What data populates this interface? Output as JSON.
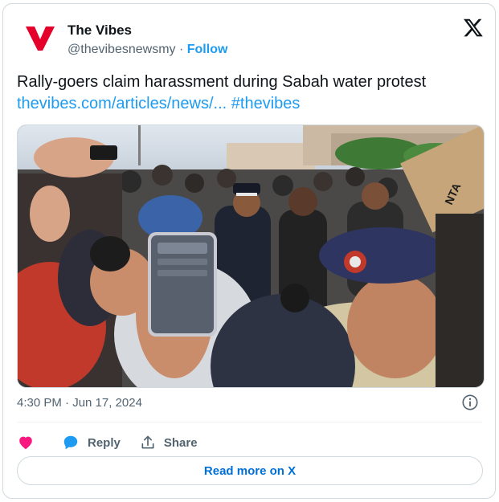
{
  "account": {
    "display_name": "The Vibes",
    "handle": "@thevibesnewsmy",
    "separator": "·",
    "follow_label": "Follow",
    "brand_color": "#e4002b"
  },
  "tweet": {
    "text": "Rally-goers claim harassment during Sabah water protest",
    "link": "thevibes.com/articles/news/...",
    "hashtag": "#thevibes"
  },
  "media": {
    "placard_text": "NTA"
  },
  "meta": {
    "timestamp": "4:30 PM · Jun 17, 2024"
  },
  "actions": {
    "reply_label": "Reply",
    "share_label": "Share"
  },
  "footer": {
    "read_more_label": "Read more on X"
  },
  "colors": {
    "accent": "#1d9bf0",
    "like": "#f91880",
    "text_muted": "#536471"
  }
}
